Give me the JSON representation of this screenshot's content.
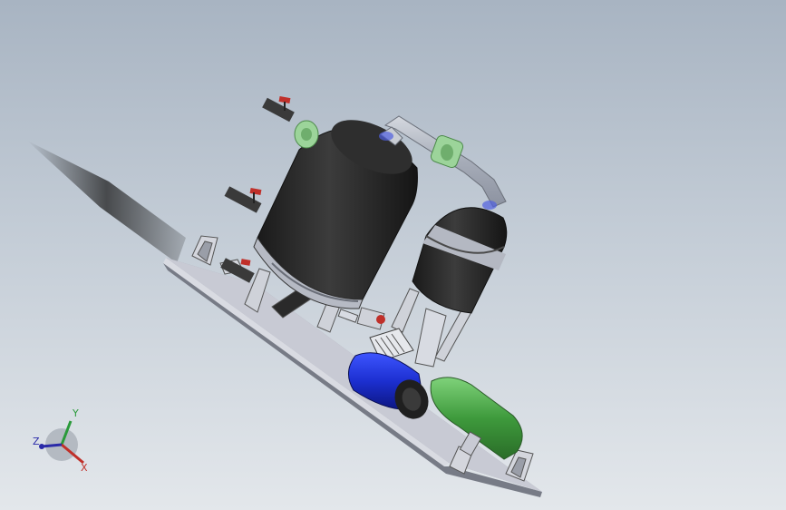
{
  "viewport": {
    "colors": {
      "background_top": "#a8b4c2",
      "background_bottom": "#e3e7eb",
      "tank_black": "#2b2b2b",
      "coupling_green": "#9cd49a",
      "pipe_gray": "#b6bcc6",
      "base_plate": "#c8cad4",
      "motor_blue": "#1c2fd0",
      "cylinder_green": "#3e9a3c"
    },
    "model": {
      "parts": [
        "large-tank",
        "small-tank",
        "connecting-pipe",
        "pipe-couplings",
        "ball-valves",
        "base-plate",
        "mounting-brackets",
        "blue-motor",
        "green-cylinder"
      ]
    }
  },
  "triad": {
    "x_label": "X",
    "y_label": "Y",
    "z_label": "Z",
    "x_color": "#c0302a",
    "y_color": "#2a9a3a",
    "z_color": "#2a2aa8"
  }
}
